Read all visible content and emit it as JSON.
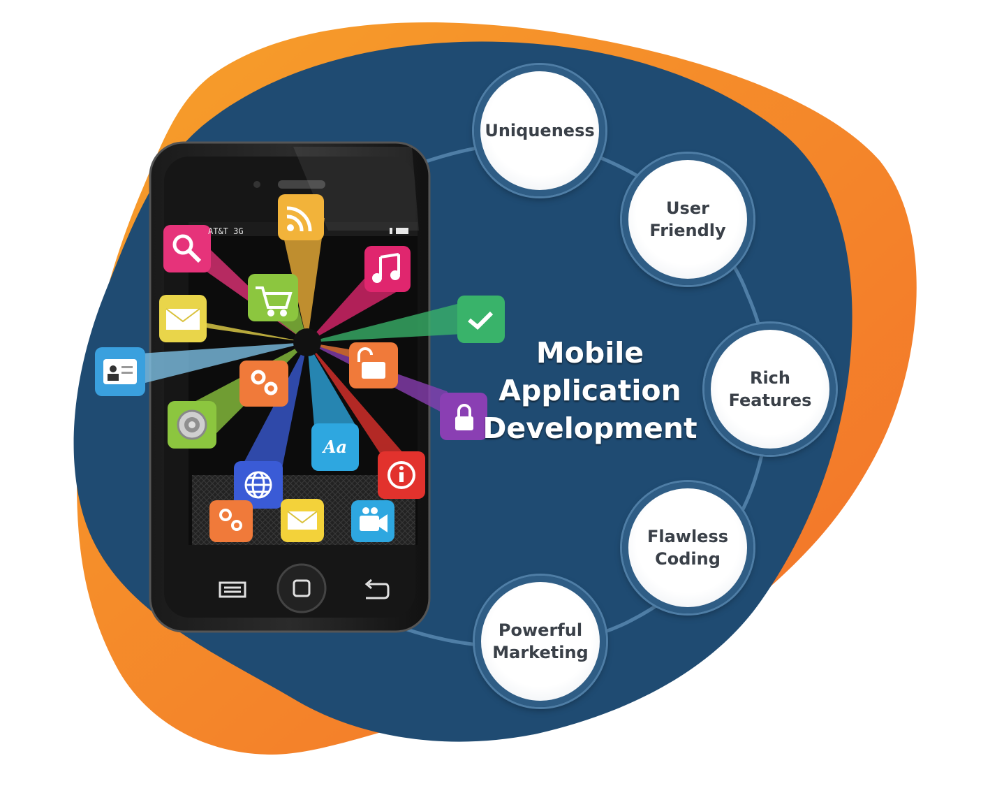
{
  "title": {
    "line1": "Mobile",
    "line2": "Application",
    "line3": "Development"
  },
  "features": [
    {
      "line1": "Uniqueness",
      "line2": ""
    },
    {
      "line1": "User",
      "line2": "Friendly"
    },
    {
      "line1": "Rich",
      "line2": "Features"
    },
    {
      "line1": "Flawless",
      "line2": "Coding"
    },
    {
      "line1": "Powerful",
      "line2": "Marketing"
    }
  ],
  "phone": {
    "status_left": "AT&T 3G",
    "nav_icons": [
      "menu-icon",
      "home-icon",
      "back-icon"
    ]
  },
  "app_icons": [
    {
      "name": "rss-icon",
      "color": "#f2b33a"
    },
    {
      "name": "search-icon",
      "color": "#e6337a"
    },
    {
      "name": "music-icon",
      "color": "#e0266e"
    },
    {
      "name": "cart-icon",
      "color": "#8cc63f"
    },
    {
      "name": "mail-icon",
      "color": "#e9d54a"
    },
    {
      "name": "check-icon",
      "color": "#39b36a"
    },
    {
      "name": "contact-card-icon",
      "color": "#3aa0de"
    },
    {
      "name": "unlock-icon",
      "color": "#f07a3a"
    },
    {
      "name": "settings-icon",
      "color": "#f07a3a"
    },
    {
      "name": "lock-icon",
      "color": "#8a3fb3"
    },
    {
      "name": "camera-lens-icon",
      "color": "#8cc63f"
    },
    {
      "name": "font-icon",
      "color": "#2ea7e0"
    },
    {
      "name": "info-icon",
      "color": "#e2322d"
    },
    {
      "name": "globe-icon",
      "color": "#3a5bd6"
    },
    {
      "name": "settings-icon",
      "color": "#f07a3a"
    },
    {
      "name": "mail-icon",
      "color": "#f3d23a"
    },
    {
      "name": "video-camera-icon",
      "color": "#2ea7e0"
    }
  ],
  "colors": {
    "navy": "#1f4b72",
    "orange": "#f58a2a",
    "bubble_ring": "#2f5d85"
  }
}
